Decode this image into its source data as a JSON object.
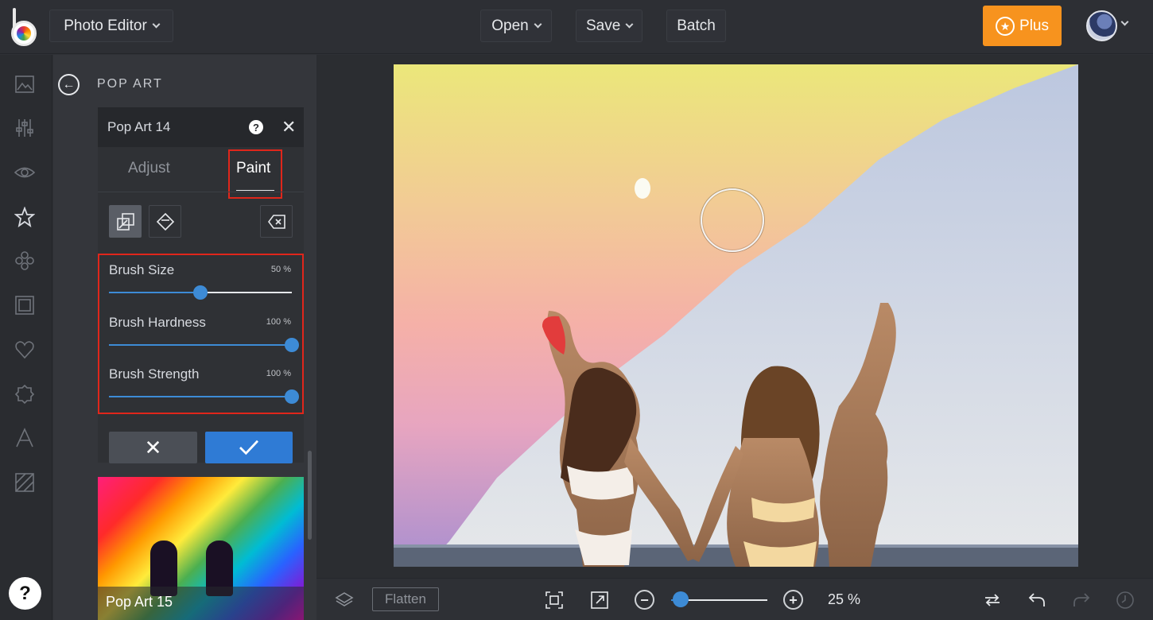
{
  "topbar": {
    "app_menu": "Photo Editor",
    "open": "Open",
    "save": "Save",
    "batch": "Batch",
    "plus": "Plus"
  },
  "panel": {
    "title": "POP ART",
    "effect_name": "Pop Art 14",
    "tabs": {
      "adjust": "Adjust",
      "paint": "Paint",
      "active": "Paint"
    },
    "sliders": [
      {
        "label": "Brush Size",
        "value_text": "50 %",
        "value": 50
      },
      {
        "label": "Brush Hardness",
        "value_text": "100 %",
        "value": 100
      },
      {
        "label": "Brush Strength",
        "value_text": "100 %",
        "value": 100
      }
    ],
    "next_thumbnail": "Pop Art 15"
  },
  "bottombar": {
    "flatten": "Flatten",
    "zoom_text": "25 %",
    "zoom_level": 0.1
  },
  "help": "?",
  "icons": {
    "rail": [
      "image-icon",
      "sliders-icon",
      "eye-icon",
      "star-icon",
      "flower-icon",
      "frame-icon",
      "heart-icon",
      "badge-icon",
      "text-icon",
      "texture-icon"
    ],
    "tools": [
      "paint-brush-icon",
      "eraser-icon",
      "clear-icon"
    ]
  },
  "colors": {
    "accent": "#3d8bd6",
    "plus": "#f7931e",
    "highlight": "#e0261b"
  }
}
